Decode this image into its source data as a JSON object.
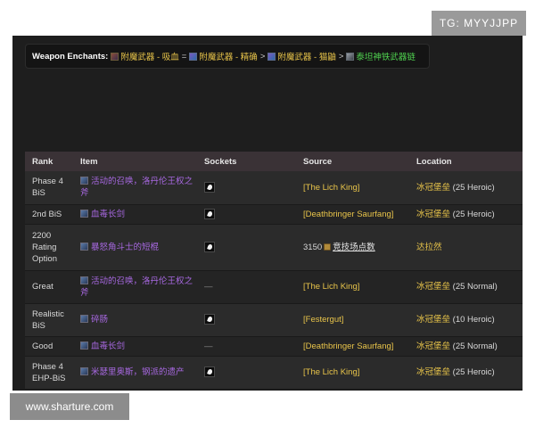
{
  "watermark_top": "TG: MYYJJPP",
  "watermark_bottom": "www.sharture.com",
  "enchants": {
    "label": "Weapon Enchants:",
    "items": [
      {
        "text": "附魔武器 - 吸血",
        "icon": "enchant-scroll-icon",
        "color": "#e8c44a"
      },
      {
        "sep": "="
      },
      {
        "text": "附魔武器 - 精确",
        "icon": "enchant-scroll-icon",
        "color": "#e8c44a"
      },
      {
        "sep": ">"
      },
      {
        "text": "附魔武器 - 猫鼬",
        "icon": "enchant-scroll-icon",
        "color": "#e8c44a"
      },
      {
        "sep": ">"
      },
      {
        "text": "泰坦神铁武器链",
        "icon": "chain-icon",
        "color": "#4fd14f"
      }
    ]
  },
  "table": {
    "headers": [
      "Rank",
      "Item",
      "Sockets",
      "Source",
      "Location"
    ],
    "rows": [
      {
        "rank": "Phase 4 BiS",
        "item": "活动的召唤，洛丹伦王权之斧",
        "socket": true,
        "source": "[The Lich King]",
        "location": "冰冠堡垒",
        "location_suffix": "(25 Heroic)"
      },
      {
        "rank": "2nd BiS",
        "item": "血毒长剑",
        "socket": true,
        "source": "[Deathbringer Saurfang]",
        "location": "冰冠堡垒",
        "location_suffix": "(25 Heroic)"
      },
      {
        "rank": "2200 Rating Option",
        "item": "暴怒角斗士的短棍",
        "socket": true,
        "source_prefix": "3150",
        "source": "竞技场点数",
        "location": "达拉然",
        "location_suffix": ""
      },
      {
        "rank": "Great",
        "item": "活动的召唤，洛丹伦王权之斧",
        "socket": false,
        "source": "[The Lich King]",
        "location": "冰冠堡垒",
        "location_suffix": "(25 Normal)"
      },
      {
        "rank": "Realistic BiS",
        "item": "碎肠",
        "socket": true,
        "source": "[Festergut]",
        "location": "冰冠堡垒",
        "location_suffix": "(10 Heroic)"
      },
      {
        "rank": "Good",
        "item": "血毒长剑",
        "socket": false,
        "source": "[Deathbringer Saurfang]",
        "location": "冰冠堡垒",
        "location_suffix": "(25 Normal)"
      },
      {
        "rank": "Phase 4 EHP-BiS",
        "item": "米瑟里奥斯，钢派的遗产",
        "socket": true,
        "source": "[The Lich King]",
        "location": "冰冠堡垒",
        "location_suffix": "(25 Heroic)"
      }
    ],
    "empty_socket": "—"
  }
}
